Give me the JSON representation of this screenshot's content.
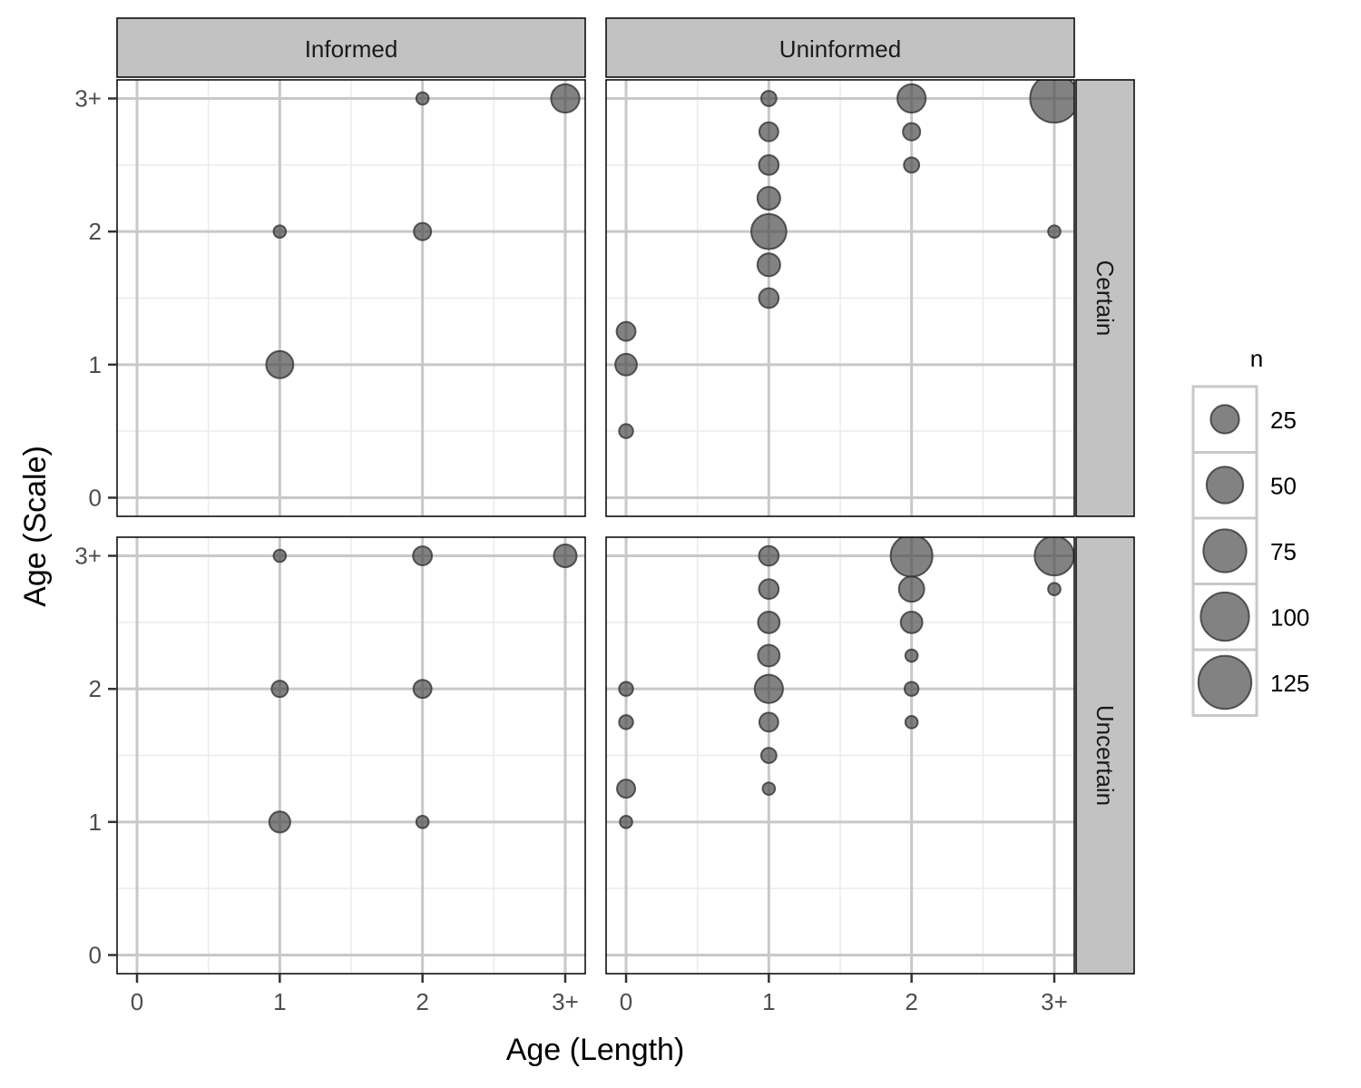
{
  "chart_data": {
    "type": "scatter",
    "subtype": "bubble-facet",
    "xlabel": "Age (Length)",
    "ylabel": "Age (Scale)",
    "x_ticks": [
      {
        "value": 0,
        "label": "0"
      },
      {
        "value": 1,
        "label": "1"
      },
      {
        "value": 2,
        "label": "2"
      },
      {
        "value": 3,
        "label": "3+"
      }
    ],
    "y_ticks": [
      {
        "value": 0,
        "label": "0"
      },
      {
        "value": 1,
        "label": "1"
      },
      {
        "value": 2,
        "label": "2"
      },
      {
        "value": 3,
        "label": "3+"
      }
    ],
    "xlim": [
      -0.14,
      3.14
    ],
    "ylim": [
      -0.14,
      3.14
    ],
    "grid": true,
    "column_facets": [
      "Informed",
      "Uninformed"
    ],
    "row_facets": [
      "Certain",
      "Uncertain"
    ],
    "size_legend": {
      "title": "n",
      "placement": "right",
      "entries": [
        {
          "value": 25,
          "label": "25"
        },
        {
          "value": 50,
          "label": "50"
        },
        {
          "value": 75,
          "label": "75"
        },
        {
          "value": 100,
          "label": "100"
        },
        {
          "value": 125,
          "label": "125"
        }
      ]
    },
    "point_color": "#4d4d4d",
    "panels": [
      {
        "col": "Informed",
        "row": "Certain",
        "points": [
          {
            "x": 2,
            "y": 3,
            "n": 1
          },
          {
            "x": 3,
            "y": 3,
            "n": 25
          },
          {
            "x": 1,
            "y": 2,
            "n": 1
          },
          {
            "x": 2,
            "y": 2,
            "n": 5
          },
          {
            "x": 1,
            "y": 1,
            "n": 22
          }
        ]
      },
      {
        "col": "Uninformed",
        "row": "Certain",
        "points": [
          {
            "x": 1,
            "y": 3,
            "n": 3
          },
          {
            "x": 1,
            "y": 2.75,
            "n": 7
          },
          {
            "x": 1,
            "y": 2.5,
            "n": 8
          },
          {
            "x": 1,
            "y": 2.25,
            "n": 13
          },
          {
            "x": 1,
            "y": 2,
            "n": 45
          },
          {
            "x": 1,
            "y": 1.75,
            "n": 13
          },
          {
            "x": 1,
            "y": 1.5,
            "n": 8
          },
          {
            "x": 2,
            "y": 3,
            "n": 25
          },
          {
            "x": 2,
            "y": 2.75,
            "n": 5
          },
          {
            "x": 2,
            "y": 2.5,
            "n": 3
          },
          {
            "x": 3,
            "y": 3,
            "n": 100
          },
          {
            "x": 3,
            "y": 2,
            "n": 1
          },
          {
            "x": 0,
            "y": 1.25,
            "n": 7
          },
          {
            "x": 0,
            "y": 1,
            "n": 11
          },
          {
            "x": 0,
            "y": 0.5,
            "n": 2
          }
        ]
      },
      {
        "col": "Informed",
        "row": "Uncertain",
        "points": [
          {
            "x": 1,
            "y": 3,
            "n": 1
          },
          {
            "x": 2,
            "y": 3,
            "n": 7
          },
          {
            "x": 3,
            "y": 3,
            "n": 13
          },
          {
            "x": 1,
            "y": 2,
            "n": 4
          },
          {
            "x": 2,
            "y": 2,
            "n": 6
          },
          {
            "x": 1,
            "y": 1,
            "n": 10
          },
          {
            "x": 2,
            "y": 1,
            "n": 1
          }
        ]
      },
      {
        "col": "Uninformed",
        "row": "Uncertain",
        "points": [
          {
            "x": 0,
            "y": 2,
            "n": 2
          },
          {
            "x": 0,
            "y": 1.75,
            "n": 2
          },
          {
            "x": 0,
            "y": 1.25,
            "n": 6
          },
          {
            "x": 0,
            "y": 1,
            "n": 1
          },
          {
            "x": 1,
            "y": 3,
            "n": 8
          },
          {
            "x": 1,
            "y": 2.75,
            "n": 8
          },
          {
            "x": 1,
            "y": 2.5,
            "n": 11
          },
          {
            "x": 1,
            "y": 2.25,
            "n": 11
          },
          {
            "x": 1,
            "y": 2,
            "n": 25
          },
          {
            "x": 1,
            "y": 1.75,
            "n": 7
          },
          {
            "x": 1,
            "y": 1.5,
            "n": 3
          },
          {
            "x": 1,
            "y": 1.25,
            "n": 1
          },
          {
            "x": 2,
            "y": 3,
            "n": 70
          },
          {
            "x": 2,
            "y": 2.75,
            "n": 18
          },
          {
            "x": 2,
            "y": 2.5,
            "n": 11
          },
          {
            "x": 2,
            "y": 2.25,
            "n": 1
          },
          {
            "x": 2,
            "y": 2,
            "n": 2
          },
          {
            "x": 2,
            "y": 1.75,
            "n": 1
          },
          {
            "x": 3,
            "y": 3,
            "n": 60
          },
          {
            "x": 3,
            "y": 2.75,
            "n": 1
          }
        ]
      }
    ]
  }
}
